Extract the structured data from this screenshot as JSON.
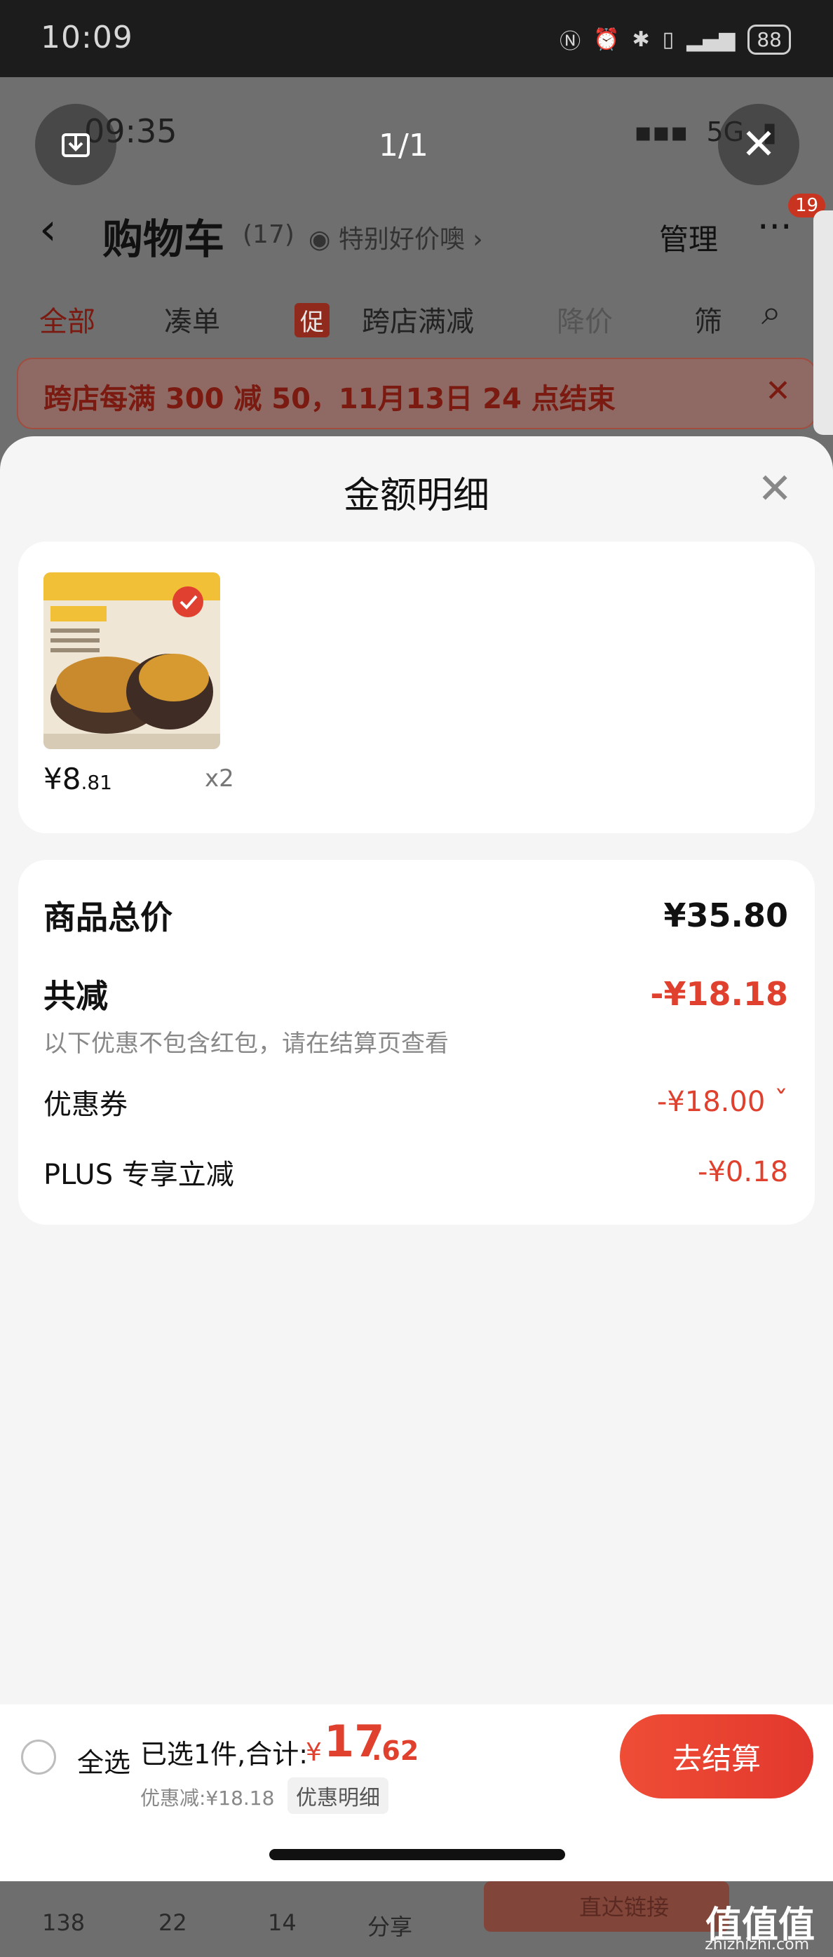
{
  "device": {
    "time": "10:09",
    "battery": "88",
    "status_icons": [
      "nfc-icon",
      "alarm-icon",
      "bluetooth-icon",
      "vibrate-icon",
      "signal-4g-icon"
    ]
  },
  "viewer": {
    "pager": "1/1",
    "download_icon": "download-icon",
    "close_icon": "close-icon"
  },
  "background": {
    "inner_time": "09:35",
    "inner_network": "5G",
    "header": {
      "back": "‹",
      "title": "购物车",
      "count": "(17)",
      "good_price": "特别好价噢 ›",
      "manage": "管理",
      "more": "···",
      "badge": "19"
    },
    "tabs": [
      "全部",
      "凑单",
      "促",
      "跨店满减",
      "降价",
      "筛"
    ],
    "promo_text": "跨店每满 300 减 50，11月13日 24 点结束",
    "promo_close": "✕",
    "bottom_nav": [
      "138",
      "22",
      "14",
      "分享"
    ],
    "bottom_btn": "直达链接"
  },
  "sheet": {
    "title": "金额明细",
    "product": {
      "price_int": "¥8",
      "price_dec": ".81",
      "qty": "x2"
    },
    "details": {
      "total_label": "商品总价",
      "total_value": "¥35.80",
      "reduce_label": "共减",
      "reduce_value": "-¥18.18",
      "note": "以下优惠不包含红包，请在结算页查看",
      "coupon_label": "优惠券",
      "coupon_value": "-¥18.00 ˇ",
      "plus_label": "PLUS 专享立减",
      "plus_value": "-¥0.18"
    }
  },
  "bottom": {
    "select_all": "全选",
    "selected": "已选1件,合计:",
    "yen": "¥",
    "total_int": "17",
    "total_dec": ".62",
    "discount": "优惠减:¥18.18",
    "detail_link": "优惠明细",
    "checkout": "去结算"
  },
  "watermark": {
    "text": "值值值",
    "sub": "zhizhizhi.com"
  },
  "colors": {
    "accent_red": "#e0412e",
    "sheet_bg": "#f5f5f5"
  }
}
